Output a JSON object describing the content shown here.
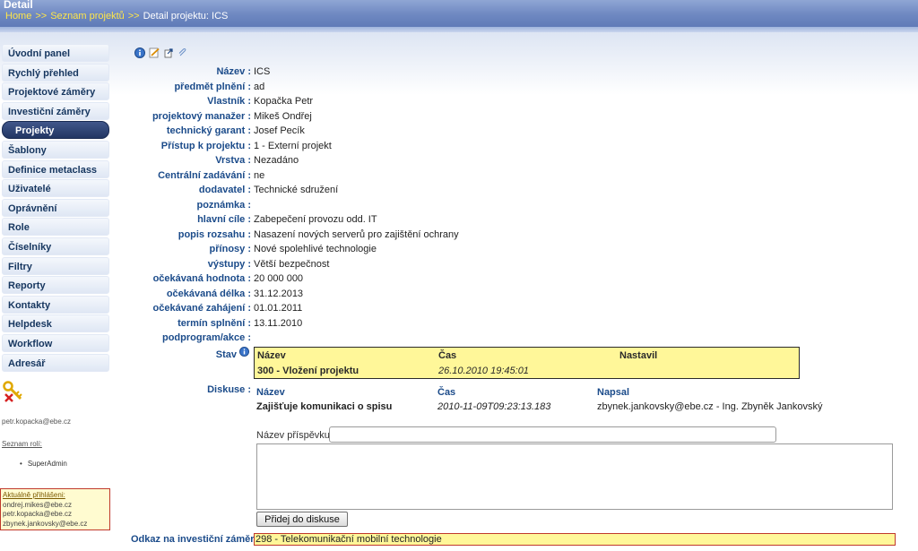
{
  "header": {
    "title": "Detail",
    "breadcrumb": [
      {
        "label": "Home",
        "link": true
      },
      {
        "label": "Seznam projektů",
        "link": true
      },
      {
        "label": "Detail projektu: ICS",
        "link": false
      }
    ],
    "separator": ">>"
  },
  "sidebar": {
    "items": [
      {
        "label": "Úvodní panel",
        "active": false
      },
      {
        "label": "Rychlý přehled",
        "active": false
      },
      {
        "label": "Projektové záměry",
        "active": false
      },
      {
        "label": "Investiční záměry",
        "active": false
      },
      {
        "label": "Projekty",
        "active": true
      },
      {
        "label": "Šablony",
        "active": false
      },
      {
        "label": "Definice metaclass",
        "active": false
      },
      {
        "label": "Uživatelé",
        "active": false
      },
      {
        "label": "Oprávnění",
        "active": false
      },
      {
        "label": "Role",
        "active": false
      },
      {
        "label": "Číselníky",
        "active": false
      },
      {
        "label": "Filtry",
        "active": false
      },
      {
        "label": "Reporty",
        "active": false
      },
      {
        "label": "Kontakty",
        "active": false
      },
      {
        "label": "Helpdesk",
        "active": false
      },
      {
        "label": "Workflow",
        "active": false
      },
      {
        "label": "Adresář",
        "active": false
      }
    ],
    "user_email": "petr.kopacka@ebe.cz",
    "roles_title": "Seznam rolí:",
    "roles": [
      "SuperAdmin"
    ],
    "logged_title": "Aktuálně přihlášeni:",
    "logged_users": [
      "ondrej.mikes@ebe.cz",
      "petr.kopacka@ebe.cz",
      "zbynek.jankovsky@ebe.cz"
    ]
  },
  "toolbar": {
    "icons": [
      "info-icon",
      "edit-icon",
      "export-icon",
      "attach-icon"
    ]
  },
  "fields": [
    {
      "label": "Název :",
      "value": "ICS"
    },
    {
      "label": "předmět plnění :",
      "value": "ad"
    },
    {
      "label": "Vlastník :",
      "value": "Kopačka Petr"
    },
    {
      "label": "projektový manažer :",
      "value": "Mikeš Ondřej"
    },
    {
      "label": "technický garant :",
      "value": "Josef Pecík"
    },
    {
      "label": "Přístup k projektu :",
      "value": "1 - Externí projekt"
    },
    {
      "label": "Vrstva :",
      "value": "Nezadáno"
    },
    {
      "label": "Centrální zadávání :",
      "value": "ne"
    },
    {
      "label": "dodavatel :",
      "value": "Technické sdružení"
    },
    {
      "label": "poznámka :",
      "value": ""
    },
    {
      "label": "hlavní cíle :",
      "value": "Zabepečení provozu odd. IT"
    },
    {
      "label": "popis rozsahu :",
      "value": "Nasazení nových serverů pro zajištění ochrany"
    },
    {
      "label": "přínosy :",
      "value": "Nové spolehlivé technologie"
    },
    {
      "label": "výstupy :",
      "value": "Větší bezpečnost"
    },
    {
      "label": "očekávaná hodnota :",
      "value": "20 000 000"
    },
    {
      "label": "očekávaná délka :",
      "value": "31.12.2013"
    },
    {
      "label": "očekávané zahájení :",
      "value": "01.01.2011"
    },
    {
      "label": "termín splnění :",
      "value": "13.11.2010"
    },
    {
      "label": "podprogram/akce :",
      "value": ""
    }
  ],
  "state": {
    "label": "Stav",
    "headers": [
      "Název",
      "Čas",
      "Nastavil"
    ],
    "row": [
      "300 - Vložení projektu",
      "26.10.2010 19:45:01",
      ""
    ]
  },
  "discussion": {
    "label": "Diskuse :",
    "headers": [
      "Název",
      "Čas",
      "Napsal"
    ],
    "rows": [
      [
        "Zajišťuje komunikaci o spisu",
        "2010-11-09T09:23:13.183",
        "zbynek.jankovsky@ebe.cz - Ing. Zbyněk Jankovský"
      ]
    ],
    "post_title_label": "Název příspěvku:",
    "post_title_value": "",
    "post_text_value": "",
    "submit_label": "Přidej do diskuse"
  },
  "investment": {
    "label": "Odkaz na investiční záměr :",
    "value": "298 - Telekomunikační mobilní technologie"
  }
}
